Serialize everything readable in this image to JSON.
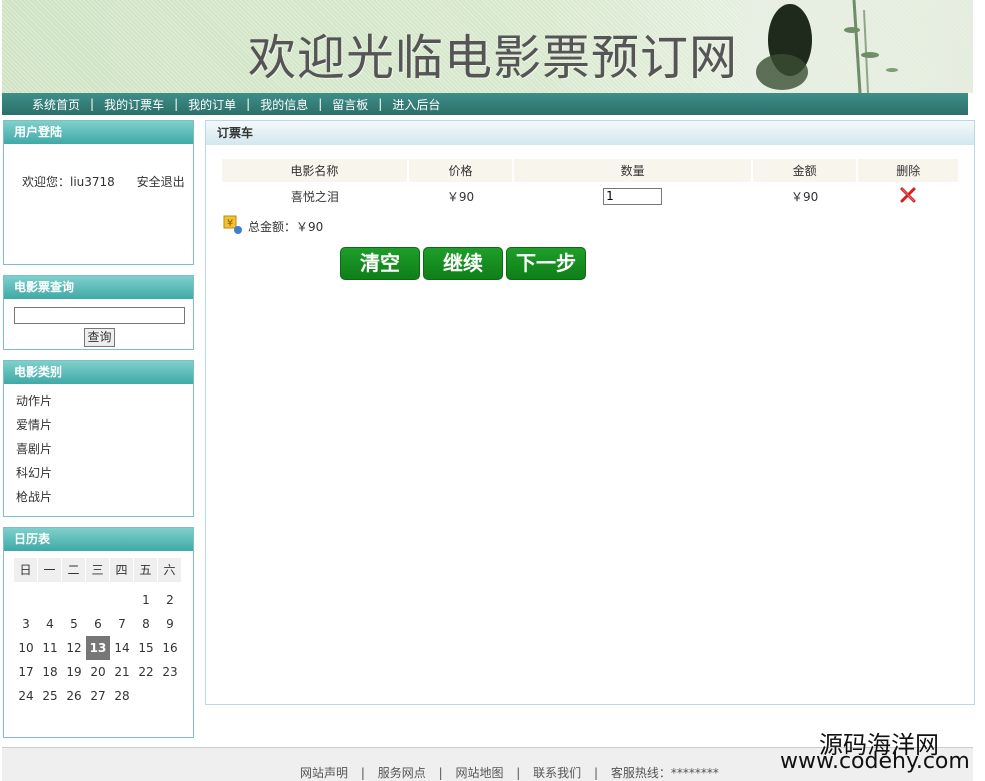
{
  "banner": {
    "title": "欢迎光临电影票预订网"
  },
  "nav": {
    "items": [
      "系统首页",
      "我的订票车",
      "我的订单",
      "我的信息",
      "留言板",
      "进入后台"
    ],
    "separator": "|"
  },
  "login": {
    "title": "用户登陆",
    "welcome": "欢迎您：liu3718",
    "logout": "安全退出"
  },
  "search": {
    "title": "电影票查询",
    "value": "",
    "button": "查询"
  },
  "categories": {
    "title": "电影类别",
    "items": [
      "动作片",
      "爱情片",
      "喜剧片",
      "科幻片",
      "枪战片"
    ]
  },
  "calendar": {
    "title": "日历表",
    "weekdays": [
      "日",
      "一",
      "二",
      "三",
      "四",
      "五",
      "六"
    ],
    "weeks": [
      [
        "",
        "",
        "",
        "",
        "",
        "1",
        "2"
      ],
      [
        "3",
        "4",
        "5",
        "6",
        "7",
        "8",
        "9"
      ],
      [
        "10",
        "11",
        "12",
        "13",
        "14",
        "15",
        "16"
      ],
      [
        "17",
        "18",
        "19",
        "20",
        "21",
        "22",
        "23"
      ],
      [
        "24",
        "25",
        "26",
        "27",
        "28",
        "",
        ""
      ]
    ],
    "today": "13"
  },
  "cart": {
    "title": "订票车",
    "columns": [
      "电影名称",
      "价格",
      "数量",
      "金额",
      "删除"
    ],
    "rows": [
      {
        "name": "喜悦之泪",
        "price": "￥90",
        "quantity": "1",
        "amount": "￥90"
      }
    ],
    "total_label": "总金额：￥90",
    "buttons": {
      "clear": "清空",
      "continue": "继续",
      "next": "下一步"
    }
  },
  "footer": {
    "links": [
      "网站声明",
      "服务网点",
      "网站地图",
      "联系我们",
      "客服热线：********"
    ],
    "separator": "|"
  },
  "watermark": {
    "line1": "源码海洋网",
    "line2": "www.codehy.com"
  },
  "colors": {
    "nav": "#2b6f6a",
    "box_head": "#3fa9a6",
    "button_green": "#0f7f18",
    "delete_red": "#d02020"
  }
}
